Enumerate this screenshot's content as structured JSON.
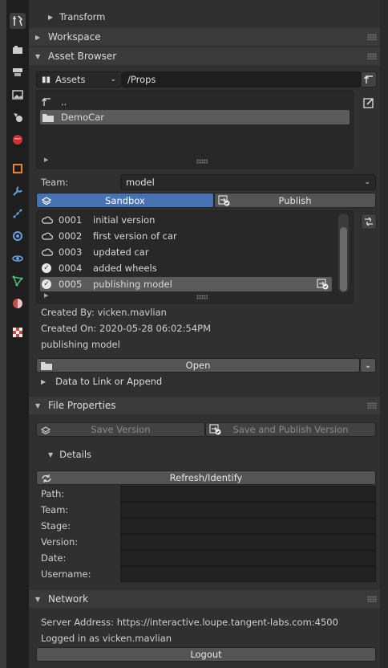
{
  "tabs": [
    {
      "name": "tool-icon",
      "glyph": "🔧"
    },
    {
      "name": "render-icon",
      "glyph": "📷"
    },
    {
      "name": "output-icon",
      "glyph": "🖨"
    },
    {
      "name": "view-layer-icon",
      "glyph": "🖼"
    },
    {
      "name": "scene-icon",
      "glyph": "⚗"
    },
    {
      "name": "world-icon",
      "glyph": "🌐"
    },
    {
      "name": "object-icon",
      "glyph": "▣"
    },
    {
      "name": "modifier-icon",
      "glyph": "🔧"
    },
    {
      "name": "particles-icon",
      "glyph": "⋰"
    },
    {
      "name": "physics-icon",
      "glyph": "◉"
    },
    {
      "name": "constraints-icon",
      "glyph": "⛓"
    },
    {
      "name": "data-icon",
      "glyph": "△"
    },
    {
      "name": "material-icon",
      "glyph": "◐"
    },
    {
      "name": "texture-icon",
      "glyph": "▦"
    }
  ],
  "transform": {
    "label": "Transform"
  },
  "workspace": {
    "label": "Workspace"
  },
  "asset_browser": {
    "label": "Asset Browser",
    "library_selected": "Assets",
    "path": "/Props",
    "parent_dir": "..",
    "folders": [
      "DemoCar"
    ],
    "team_label": "Team:",
    "team_value": "model",
    "mode_tabs": {
      "sandbox": "Sandbox",
      "publish": "Publish"
    },
    "versions": [
      {
        "num": "0001",
        "desc": "initial version",
        "state": "cloud"
      },
      {
        "num": "0002",
        "desc": "first version of car",
        "state": "cloud"
      },
      {
        "num": "0003",
        "desc": "updated car",
        "state": "cloud"
      },
      {
        "num": "0004",
        "desc": "added wheels",
        "state": "check"
      },
      {
        "num": "0005",
        "desc": "publishing model",
        "state": "check"
      }
    ],
    "created_by": "Created By: vicken.mavlian",
    "created_on": "Created On: 2020-05-28 06:02:54PM",
    "comment": "publishing model",
    "open_label": "Open",
    "data_link_label": "Data to Link or Append"
  },
  "file_properties": {
    "label": "File Properties",
    "save_version": "Save Version",
    "save_publish_version": "Save and Publish Version",
    "details_label": "Details",
    "refresh_label": "Refresh/Identify",
    "fields": [
      "Path:",
      "Team:",
      "Stage:",
      "Version:",
      "Date:",
      "Username:"
    ]
  },
  "network": {
    "label": "Network",
    "server_address": "Server Address: https://interactive.loupe.tangent-labs.com:4500",
    "logged_in": "Logged in as vicken.mavlian",
    "logout_label": "Logout"
  },
  "colors": {
    "accent_blue": "#4772b3",
    "panel": "#303030",
    "header": "#3a3a3a"
  }
}
